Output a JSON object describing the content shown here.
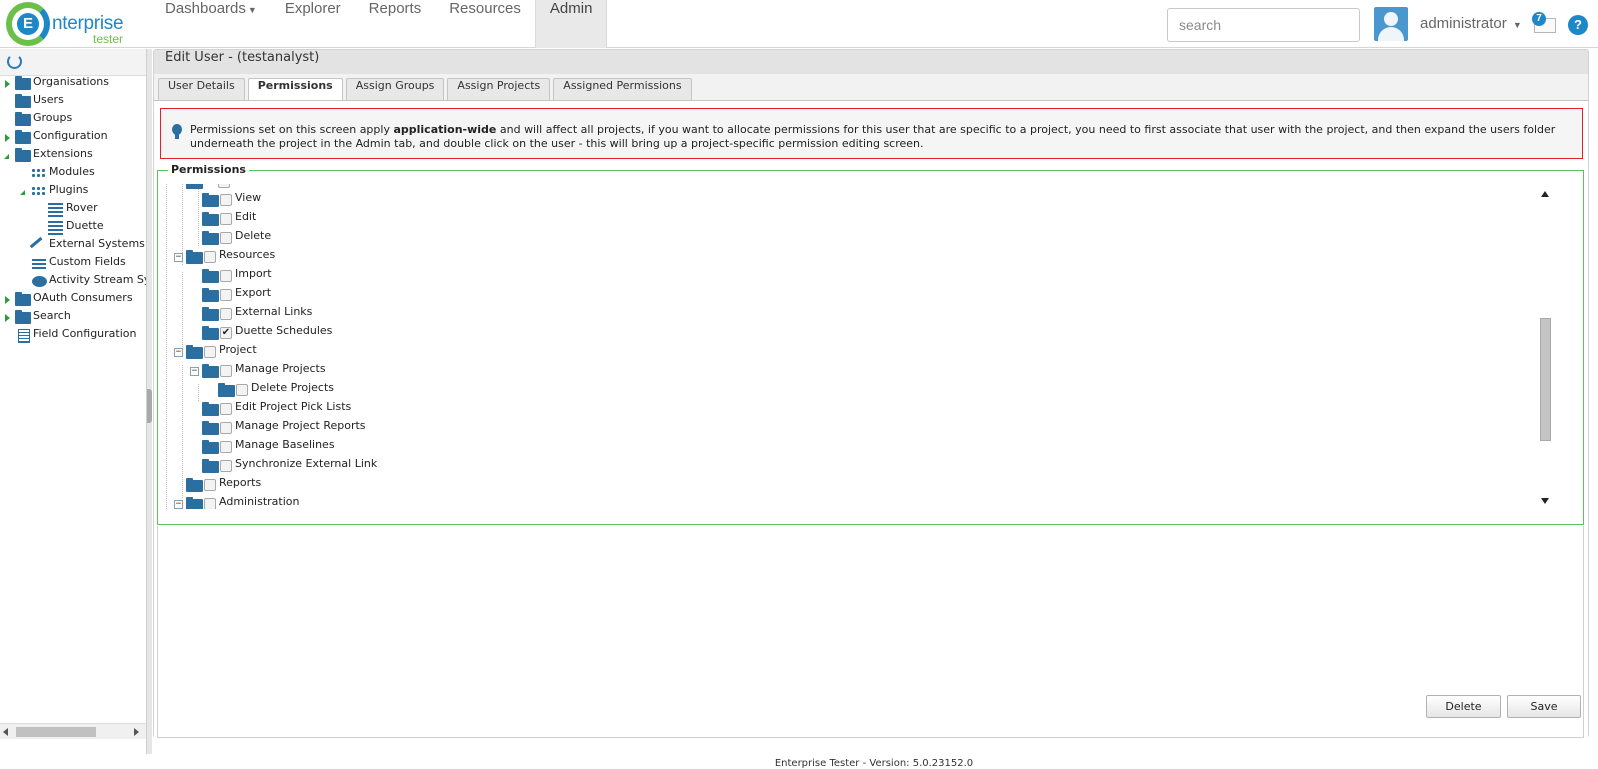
{
  "app": {
    "logo_text": "nterprise",
    "logo_letter": "E",
    "logo_sub": "tester"
  },
  "nav": {
    "items": [
      {
        "label": "Dashboards",
        "has_caret": true
      },
      {
        "label": "Explorer"
      },
      {
        "label": "Reports"
      },
      {
        "label": "Resources"
      },
      {
        "label": "Admin",
        "active": true
      }
    ]
  },
  "header": {
    "search_placeholder": "search",
    "username": "administrator",
    "mail_count": "7",
    "help": "?"
  },
  "left_tree": {
    "items": [
      {
        "label": "Organisations",
        "icon": "folder-icon",
        "expander": "collapsed"
      },
      {
        "label": "Users",
        "icon": "folder-icon"
      },
      {
        "label": "Groups",
        "icon": "folder-icon"
      },
      {
        "label": "Configuration",
        "icon": "folder-icon",
        "expander": "collapsed"
      },
      {
        "label": "Extensions",
        "icon": "folder-icon",
        "expander": "expanded"
      },
      {
        "label": "Modules",
        "icon": "grid-icon"
      },
      {
        "label": "Plugins",
        "icon": "grid-icon",
        "expander": "expanded"
      },
      {
        "label": "Rover",
        "icon": "list-icon"
      },
      {
        "label": "Duette",
        "icon": "list-icon"
      },
      {
        "label": "External Systems",
        "icon": "link-icon"
      },
      {
        "label": "Custom Fields",
        "icon": "fields-icon"
      },
      {
        "label": "Activity Stream Sync",
        "icon": "bubble-icon"
      },
      {
        "label": "OAuth Consumers",
        "icon": "folder-icon",
        "expander": "collapsed"
      },
      {
        "label": "Search",
        "icon": "folder-icon",
        "expander": "collapsed"
      },
      {
        "label": "Field Configuration",
        "icon": "doc-icon"
      }
    ]
  },
  "panel": {
    "title": "Edit User - (testanalyst)",
    "tabs": [
      {
        "label": "User Details"
      },
      {
        "label": "Permissions",
        "active": true
      },
      {
        "label": "Assign Groups"
      },
      {
        "label": "Assign Projects"
      },
      {
        "label": "Assigned Permissions"
      }
    ],
    "notice": {
      "before": "Permissions set on this screen apply ",
      "bold": "application-wide",
      "after": " and will affect all projects, if you want to allocate permissions for this user that are specific to a project, you need to first associate that user with the project, and then expand the users folder underneath the project in the Admin tab, and double click on the user - this will bring up a project-specific permission editing screen."
    },
    "permissions_legend": "Permissions",
    "permission_rows": [
      {
        "label": "View",
        "checked": false
      },
      {
        "label": "Edit",
        "checked": false
      },
      {
        "label": "Delete",
        "checked": false
      },
      {
        "label": "Resources",
        "checked": false,
        "collapse": "−"
      },
      {
        "label": "Import",
        "checked": false
      },
      {
        "label": "Export",
        "checked": false
      },
      {
        "label": "External Links",
        "checked": false
      },
      {
        "label": "Duette Schedules",
        "checked": true
      },
      {
        "label": "Project",
        "checked": false,
        "collapse": "−"
      },
      {
        "label": "Manage Projects",
        "checked": false,
        "collapse": "−"
      },
      {
        "label": "Delete Projects",
        "checked": false
      },
      {
        "label": "Edit Project Pick Lists",
        "checked": false
      },
      {
        "label": "Manage Project Reports",
        "checked": false
      },
      {
        "label": "Manage Baselines",
        "checked": false
      },
      {
        "label": "Synchronize External Link",
        "checked": false
      },
      {
        "label": "Reports",
        "checked": false
      },
      {
        "label": "Administration",
        "checked": false,
        "collapse": "−"
      }
    ],
    "check_mark": "✔",
    "buttons": {
      "delete": "Delete",
      "save": "Save"
    }
  },
  "footer": {
    "text": "Enterprise Tester - Version: 5.0.23152.0"
  },
  "colors": {
    "brand_blue": "#1e87c8",
    "brand_green": "#6cc04a",
    "folder_blue": "#2a6fa0",
    "notice_border": "#e0202a",
    "fieldset_border": "#5ec05e"
  }
}
